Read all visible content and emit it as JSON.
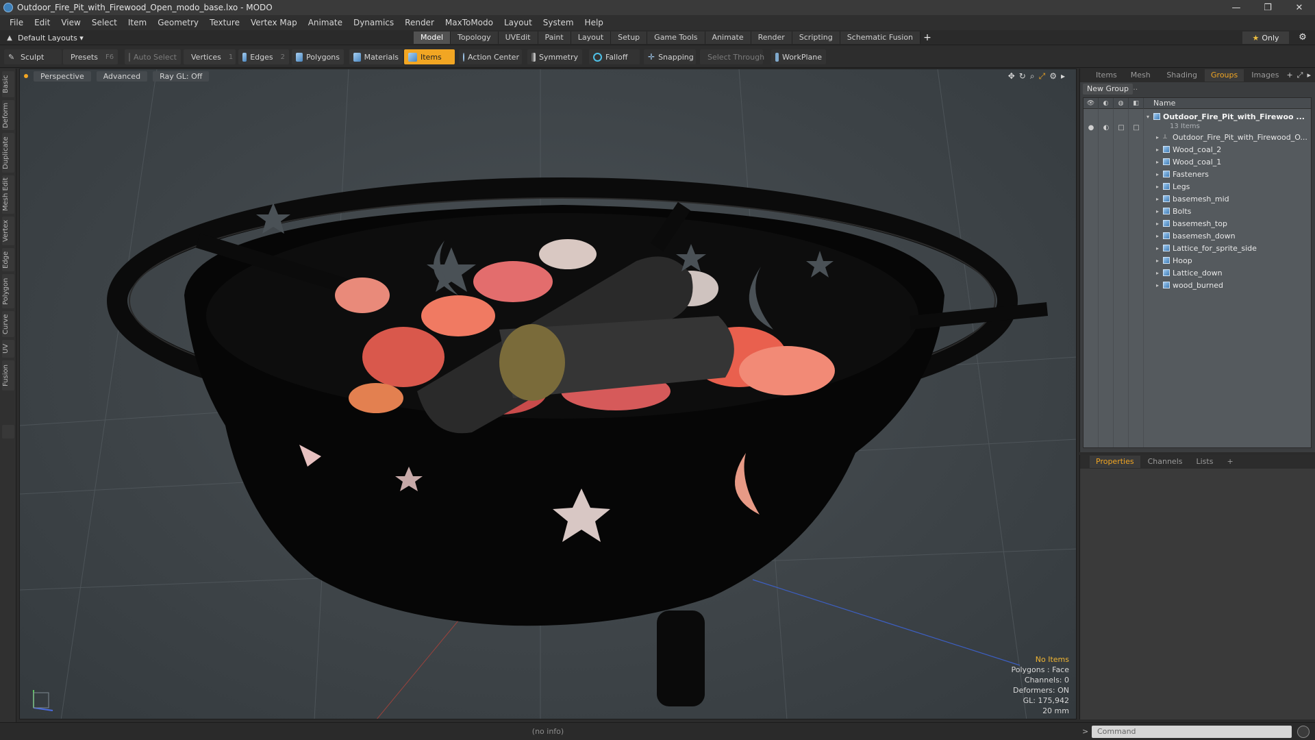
{
  "window": {
    "title": "Outdoor_Fire_Pit_with_Firewood_Open_modo_base.lxo - MODO",
    "minimize": "—",
    "maximize": "❐",
    "close": "✕"
  },
  "menu": [
    "File",
    "Edit",
    "View",
    "Select",
    "Item",
    "Geometry",
    "Texture",
    "Vertex Map",
    "Animate",
    "Dynamics",
    "Render",
    "MaxToModo",
    "Layout",
    "System",
    "Help"
  ],
  "layout_bar": {
    "layout_name": "Default Layouts ▾",
    "tabs": [
      "Model",
      "Topology",
      "UVEdit",
      "Paint",
      "Layout",
      "Setup",
      "Game Tools",
      "Animate",
      "Render",
      "Scripting",
      "Schematic Fusion"
    ],
    "active_tab": "Model",
    "plus": "+",
    "only_star": "★",
    "only_label": "Only",
    "gear": "⚙"
  },
  "toolbar": {
    "sculpt": "Sculpt",
    "presets": "Presets",
    "presets_key": "F6",
    "auto_select": "Auto Select",
    "vertices": "Vertices",
    "vertices_key": "1",
    "edges": "Edges",
    "edges_key": "2",
    "polygons": "Polygons",
    "materials": "Materials",
    "items": "Items",
    "action_center": "Action Center",
    "symmetry": "Symmetry",
    "falloff": "Falloff",
    "snapping": "Snapping",
    "select_through": "Select Through",
    "workplane": "WorkPlane"
  },
  "left_tabs": [
    "Basic",
    "Deform",
    "Duplicate",
    "Mesh Edit",
    "Vertex",
    "Edge",
    "Polygon",
    "Curve",
    "UV",
    "Fusion"
  ],
  "viewport": {
    "view_mode": "Perspective",
    "shading": "Advanced",
    "raygl": "Ray GL: Off",
    "info": {
      "no_items": "No Items",
      "polygons": "Polygons : Face",
      "channels": "Channels: 0",
      "deformers": "Deformers: ON",
      "gl": "GL: 175,942",
      "unit": "20 mm"
    }
  },
  "right_panel": {
    "tabs": [
      "Items",
      "Mesh ...",
      "Shading",
      "Groups",
      "Images"
    ],
    "active_tab": "Groups",
    "new_group": "New Group",
    "name_header": "Name",
    "root": {
      "name": "Outdoor_Fire_Pit_with_Firewoo ...",
      "count": "13 Items"
    },
    "items": [
      "Outdoor_Fire_Pit_with_Firewood_O...",
      "Wood_coal_2",
      "Wood_coal_1",
      "Fasteners",
      "Legs",
      "basemesh_mid",
      "Bolts",
      "basemesh_top",
      "basemesh_down",
      "Lattice_for_sprite_side",
      "Hoop",
      "Lattice_down",
      "wood_burned"
    ]
  },
  "props_panel": {
    "tabs": [
      "Properties",
      "Channels",
      "Lists"
    ],
    "active_tab": "Properties",
    "plus": "+"
  },
  "status": {
    "info": "(no info)",
    "command_placeholder": "Command"
  },
  "colors": {
    "accent": "#f2a623",
    "viewport_bg": "#3e4448",
    "panel_bg": "#555a5e"
  }
}
